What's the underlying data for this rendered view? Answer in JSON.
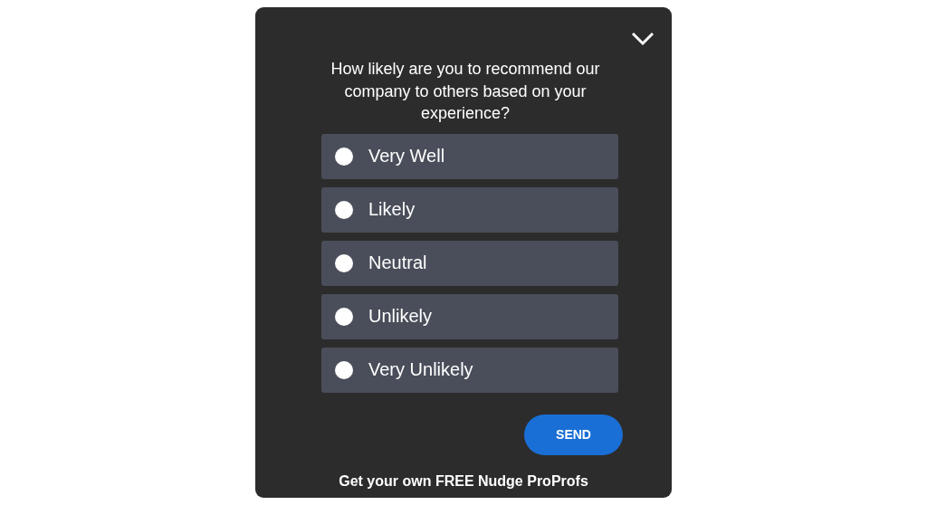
{
  "question": "How likely are you to recommend our company to others based on your experience?",
  "options": [
    {
      "label": "Very Well",
      "selected": false
    },
    {
      "label": "Likely",
      "selected": false
    },
    {
      "label": "Neutral",
      "selected": false
    },
    {
      "label": "Unlikely",
      "selected": false
    },
    {
      "label": "Very Unlikely",
      "selected": false
    }
  ],
  "send_button": "SEND",
  "footer": "Get your own FREE Nudge ProProfs"
}
